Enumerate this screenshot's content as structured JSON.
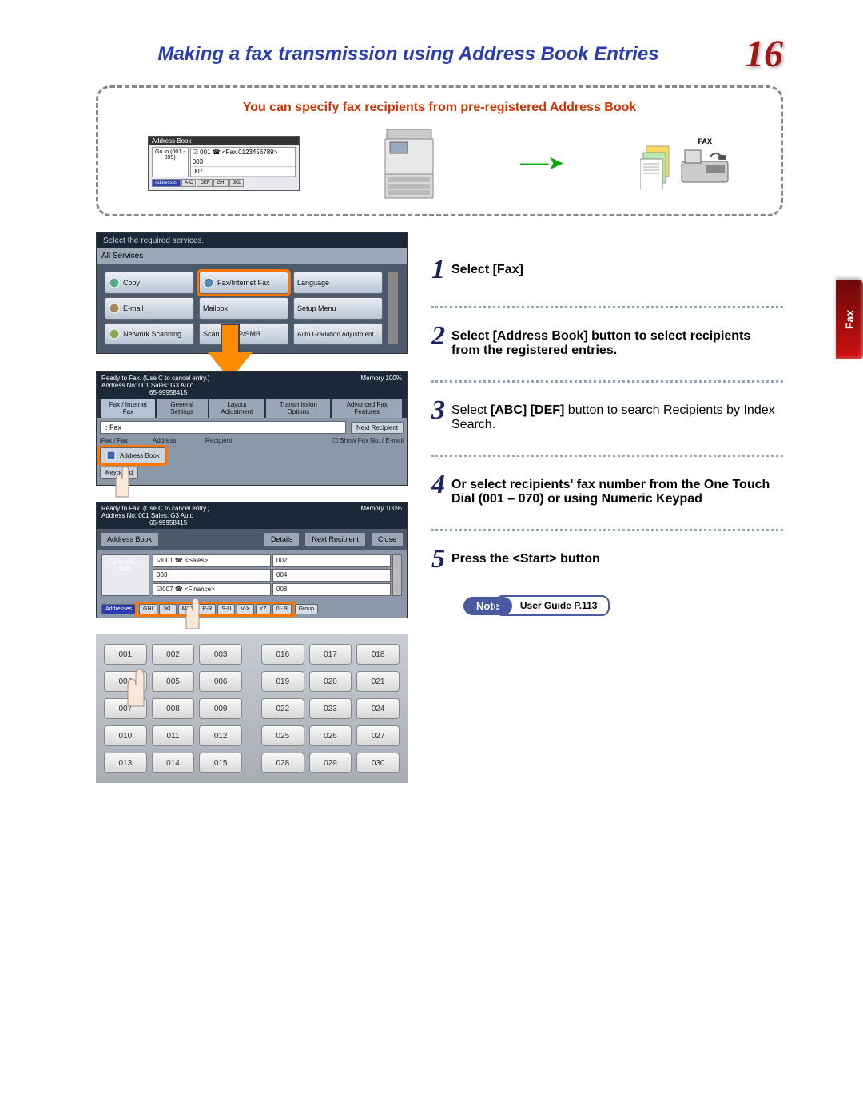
{
  "header": {
    "title": "Making a fax transmission using Address Book Entries",
    "page_number": "16"
  },
  "callout": {
    "text": "You can specify fax recipients from pre-registered Address Book",
    "mini_addrbook": {
      "title": "Address Book",
      "goto_label": "Go to\n(001 - 999)",
      "entries": [
        "001 ☎ <Fax 0123456789>",
        "003",
        "007"
      ],
      "tabs": [
        "Addresses",
        "A-C",
        "DEF",
        "GHI",
        "JKL"
      ]
    },
    "fax_label": "FAX"
  },
  "screen1": {
    "header": "Select the required services.",
    "all_services": "All Services",
    "services": [
      {
        "label": "Copy"
      },
      {
        "label": "Fax/Internet Fax"
      },
      {
        "label": "Language"
      },
      {
        "label": "E-mail"
      },
      {
        "label": "Mailbox"
      },
      {
        "label": "Setup Menu"
      },
      {
        "label": "Network Scanning"
      },
      {
        "label": "Scan to FTP/SMB"
      },
      {
        "label": "Auto Gradation Adjustment"
      }
    ]
  },
  "screen2": {
    "ready_line1": "Ready to Fax. (Use C to cancel entry.)",
    "ready_line2": "Address No: 001  Sales: G3 Auto",
    "ready_line3": "65-99958415",
    "memory": "Memory 100%",
    "tabs": [
      "Fax / Internet Fax",
      "General Settings",
      "Layout Adjustment",
      "Transmission Options",
      "Advanced Fax Features"
    ],
    "fax_prefix": ": Fax",
    "next_recipient": "Next Recipient",
    "row_labels": {
      "ifax": "iFax / Fax",
      "address": "Address",
      "recipient": "Recipient"
    },
    "show_fax": "Show Fax No. / E-mail",
    "address_book": "Address Book",
    "keyboard": "Keyboard"
  },
  "screen3": {
    "ready_line1": "Ready to Fax. (Use C to cancel entry.)",
    "ready_line2": "Address No: 001  Sales: G3 Auto",
    "ready_line3": "65-99958415",
    "memory": "Memory 100%",
    "address_book": "Address Book",
    "details": "Details",
    "next_recipient": "Next Recipient",
    "close": "Close",
    "goto_label": "Go to\n(001 - 999)",
    "entries_left": [
      "☑001 ☎ <Sales>",
      "003",
      "☑007 ☎ <Finance>"
    ],
    "entries_right": [
      "002",
      "004",
      "008"
    ],
    "filters": [
      "Addresses",
      "GHI",
      "JKL",
      "M-O",
      "P-R",
      "S-U",
      "V-X",
      "YZ",
      "0 - 9",
      "Group"
    ]
  },
  "keypad": {
    "left": [
      "001",
      "002",
      "003",
      "004",
      "005",
      "006",
      "007",
      "008",
      "009",
      "010",
      "011",
      "012",
      "013",
      "014",
      "015"
    ],
    "right": [
      "016",
      "017",
      "018",
      "019",
      "020",
      "021",
      "022",
      "023",
      "024",
      "025",
      "026",
      "027",
      "028",
      "029",
      "030"
    ]
  },
  "steps": {
    "s1": {
      "num": "1",
      "text": "Select [Fax]"
    },
    "s2": {
      "num": "2",
      "bold": "Select [Address Book] button to select recipients from the registered entries."
    },
    "s3": {
      "num": "3",
      "text_a": "Select ",
      "bold": "[ABC] [DEF]",
      "text_b": " button to search Recipients by Index Search."
    },
    "s4": {
      "num": "4",
      "bold": "Or select recipients' fax number from the One Touch Dial (001 – 070) or using Numeric Keypad"
    },
    "s5": {
      "num": "5",
      "bold": "Press the <Start> button"
    }
  },
  "side_tab": "Fax",
  "note": {
    "label": "Note",
    "text": "User Guide P.113"
  }
}
